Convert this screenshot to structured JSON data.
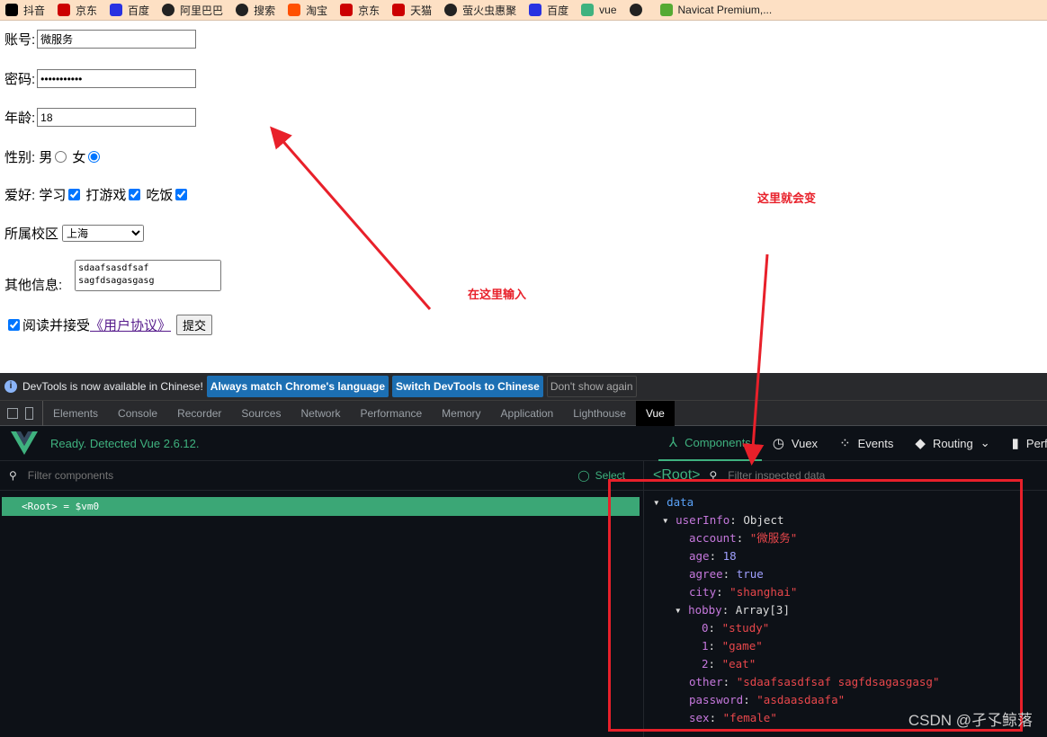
{
  "bookmarks": [
    {
      "label": "抖音",
      "icon": "tiktok-icon",
      "color": "#000"
    },
    {
      "label": "京东",
      "icon": "jd-icon",
      "color": "#c00"
    },
    {
      "label": "百度",
      "icon": "baidu-icon",
      "color": "#2932e1"
    },
    {
      "label": "阿里巴巴",
      "icon": "globe-icon",
      "color": "#222"
    },
    {
      "label": "搜索",
      "icon": "globe-icon",
      "color": "#222"
    },
    {
      "label": "淘宝",
      "icon": "taobao-icon",
      "color": "#ff5000"
    },
    {
      "label": "京东",
      "icon": "jd-icon",
      "color": "#c00"
    },
    {
      "label": "天猫",
      "icon": "tmall-icon",
      "color": "#c00"
    },
    {
      "label": "萤火虫惠聚",
      "icon": "globe-icon",
      "color": "#222"
    },
    {
      "label": "百度",
      "icon": "baidu-icon",
      "color": "#2932e1"
    },
    {
      "label": "vue",
      "icon": "vue-icon",
      "color": "#3fb27f"
    },
    {
      "label": "",
      "icon": "globe-icon",
      "color": "#222"
    },
    {
      "label": "Navicat Premium,...",
      "icon": "navicat-icon",
      "color": "#5a3"
    }
  ],
  "form": {
    "account_label": "账号:",
    "account": "微服务",
    "password_label": "密码:",
    "password": "asdaasdaafa",
    "age_label": "年龄:",
    "age": "18",
    "sex_label": "性别:",
    "male": "男",
    "female": "女",
    "hobby_label": "爱好:",
    "hobby1": "学习",
    "hobby2": "打游戏",
    "hobby3": "吃饭",
    "city_label": "所属校区",
    "city": "上海",
    "other_label": "其他信息:",
    "other": "sdaafsasdfsaf sagfdsagasgasg",
    "agree_text": "阅读并接受",
    "agreement_link": "《用户协议》",
    "submit": "提交"
  },
  "annotations": {
    "input_here": "在这里输入",
    "changes_here": "这里就会变"
  },
  "infobar": {
    "text": "DevTools is now available in Chinese!",
    "btn1": "Always match Chrome's language",
    "btn2": "Switch DevTools to Chinese",
    "btn3": "Don't show again"
  },
  "tabs": [
    "Elements",
    "Console",
    "Recorder",
    "Sources",
    "Network",
    "Performance",
    "Memory",
    "Application",
    "Lighthouse",
    "Vue"
  ],
  "vue": {
    "ready": "Ready. Detected Vue 2.6.12.",
    "tabs": [
      "Components",
      "Vuex",
      "Events",
      "Routing",
      "Perfo"
    ],
    "filter_components": "Filter components",
    "select": "Select",
    "root": "<Root>",
    "root_vm": "= $vm0",
    "filter_inspected": "Filter inspected data",
    "accent": "#3fb27f"
  },
  "tree": {
    "data": "data",
    "userInfo": "userInfo",
    "object": "Object",
    "account": "\"微服务\"",
    "age": "18",
    "agree": "true",
    "city": "\"shanghai\"",
    "hobby": "Array[3]",
    "h0": "\"study\"",
    "h1": "\"game\"",
    "h2": "\"eat\"",
    "other": "\"sdaafsasdfsaf sagfdsagasgasg\"",
    "password": "\"asdaasdaafa\"",
    "sex": "\"female\""
  },
  "watermark": "CSDN @孑孓鲸落"
}
